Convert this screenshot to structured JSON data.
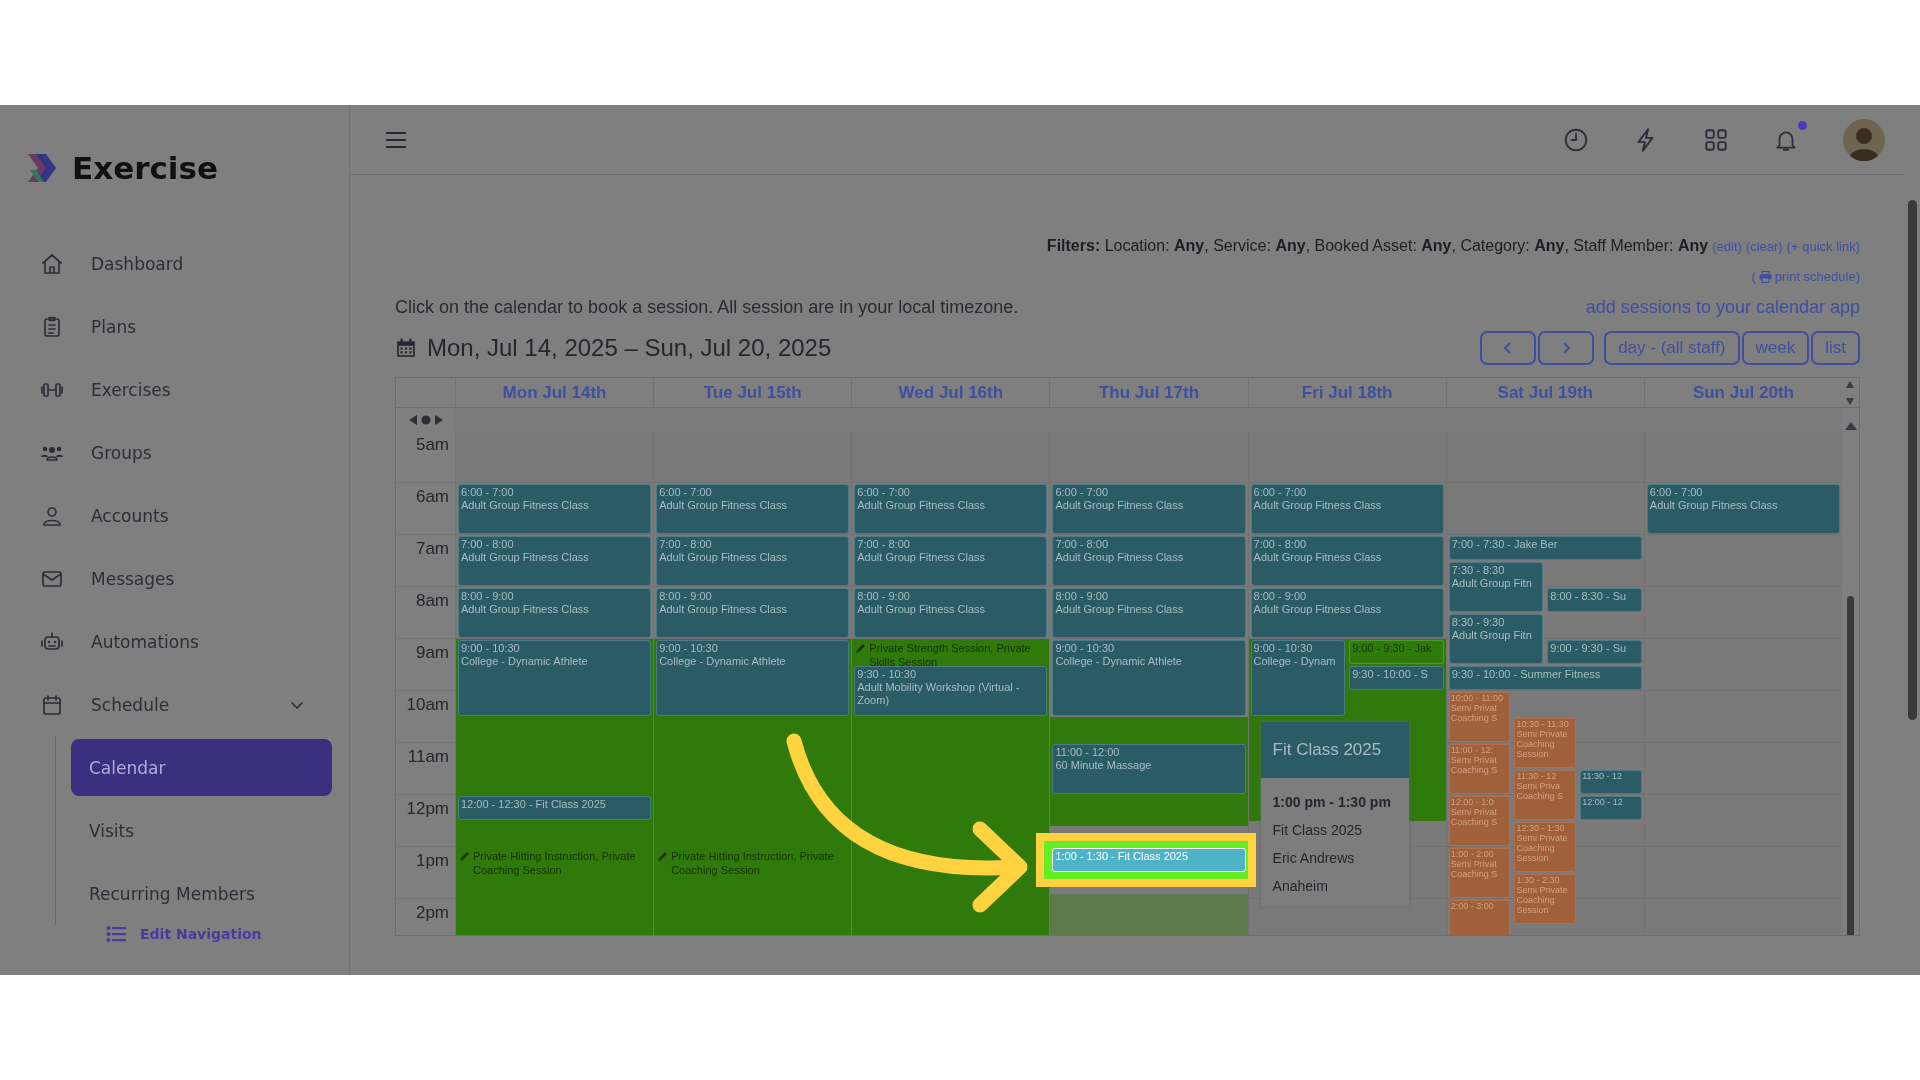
{
  "app": {
    "name": "Exercise"
  },
  "sidebar": {
    "items": [
      {
        "label": "Dashboard"
      },
      {
        "label": "Plans"
      },
      {
        "label": "Exercises"
      },
      {
        "label": "Groups"
      },
      {
        "label": "Accounts"
      },
      {
        "label": "Messages"
      },
      {
        "label": "Automations"
      },
      {
        "label": "Schedule",
        "expanded": true,
        "children": [
          {
            "label": "Calendar",
            "selected": true
          },
          {
            "label": "Visits",
            "selected": false
          },
          {
            "label": "Recurring Members",
            "selected": false
          }
        ]
      }
    ],
    "edit_link": "Edit Navigation"
  },
  "topbar": {
    "notifications_unread": true
  },
  "filters": {
    "text": "**Filters:** Location: **Any**, Service: **Any**, Booked Asset: **Any**, Category: **Any**, Staff Member: **Any**",
    "links": [
      "(edit)",
      "(clear)",
      "(+ quick link)"
    ]
  },
  "print_link": {
    "parts": [
      "(",
      "print schedule)"
    ]
  },
  "instructions": "Click on the calendar to book a session. All session are in your local timezone.",
  "calendar_app_link": "add sessions to your calendar app",
  "date_range": "Mon, Jul 14, 2025 – Sun, Jul 20, 2025",
  "view_buttons": [
    "day - (all staff)",
    "week",
    "list"
  ],
  "calendar": {
    "hours": [
      "5am",
      "6am",
      "7am",
      "8am",
      "9am",
      "10am",
      "11am",
      "12pm",
      "1pm",
      "2pm"
    ],
    "days": [
      {
        "header": "Mon Jul 14th",
        "availability": [
          {
            "kind": "open"
          },
          {
            "kind": "open",
            "label": "Private Hitting Instruction, Private Coaching Session"
          }
        ],
        "events": [
          {
            "kind": "class",
            "time": "6:00 - 7:00",
            "title": "Adult Group Fitness Class",
            "highlighted": false
          },
          {
            "kind": "class",
            "time": "7:00 - 8:00",
            "title": "Adult Group Fitness Class",
            "highlighted": false
          },
          {
            "kind": "class",
            "time": "8:00 - 9:00",
            "title": "Adult Group Fitness Class",
            "highlighted": false
          },
          {
            "kind": "class",
            "time": "9:00 - 10:30",
            "title": "College - Dynamic Athlete",
            "highlighted": false
          },
          {
            "kind": "class",
            "time": "12:00 - 12:30 - Fit Class 2025",
            "highlighted": false
          }
        ]
      },
      {
        "header": "Tue Jul 15th",
        "availability": [
          {
            "kind": "open"
          },
          {
            "kind": "open",
            "label": "Private Hitting Instruction, Private Coaching Session"
          }
        ],
        "events": [
          {
            "kind": "class",
            "time": "6:00 - 7:00",
            "title": "Adult Group Fitness Class",
            "highlighted": false
          },
          {
            "kind": "class",
            "time": "7:00 - 8:00",
            "title": "Adult Group Fitness Class",
            "highlighted": false
          },
          {
            "kind": "class",
            "time": "8:00 - 9:00",
            "title": "Adult Group Fitness Class",
            "highlighted": false
          },
          {
            "kind": "class",
            "time": "9:00 - 10:30",
            "title": "College - Dynamic Athlete",
            "highlighted": false
          }
        ]
      },
      {
        "header": "Wed Jul 16th",
        "availability": [
          {
            "kind": "open",
            "label": "Private Strength Session, Private Skills Session"
          },
          {
            "kind": "open"
          }
        ],
        "events": [
          {
            "kind": "class",
            "time": "6:00 - 7:00",
            "title": "Adult Group Fitness Class",
            "highlighted": false
          },
          {
            "kind": "class",
            "time": "7:00 - 8:00",
            "title": "Adult Group Fitness Class",
            "highlighted": false
          },
          {
            "kind": "class",
            "time": "8:00 - 9:00",
            "title": "Adult Group Fitness Class",
            "highlighted": false
          },
          {
            "kind": "class",
            "time": "9:30 - 10:30",
            "title": "Adult Mobility Workshop (Virtual - Zoom)",
            "highlighted": false
          }
        ]
      },
      {
        "header": "Thu Jul 17th",
        "availability": [
          {
            "kind": "open"
          },
          {
            "kind": "faded"
          }
        ],
        "events": [
          {
            "kind": "class",
            "time": "6:00 - 7:00",
            "title": "Adult Group Fitness Class",
            "highlighted": false
          },
          {
            "kind": "class",
            "time": "7:00 - 8:00",
            "title": "Adult Group Fitness Class",
            "highlighted": false
          },
          {
            "kind": "class",
            "time": "8:00 - 9:00",
            "title": "Adult Group Fitness Class",
            "highlighted": false
          },
          {
            "kind": "class",
            "time": "9:00 - 10:30",
            "title": "College - Dynamic Athlete",
            "highlighted": false
          },
          {
            "kind": "class",
            "time": "11:00 - 12:00",
            "title": "60 Minute Massage",
            "highlighted": false
          },
          {
            "kind": "class",
            "time": "1:00 - 1:30 - Fit Class 2025",
            "highlighted": true
          }
        ]
      },
      {
        "header": "Fri Jul 18th",
        "availability": [
          {
            "kind": "open"
          }
        ],
        "events": [
          {
            "kind": "class",
            "time": "6:00 - 7:00",
            "title": "Adult Group Fitness Class",
            "highlighted": false
          },
          {
            "kind": "class",
            "time": "7:00 - 8:00",
            "title": "Adult Group Fitness Class",
            "highlighted": false
          },
          {
            "kind": "class",
            "time": "8:00 - 9:00",
            "title": "Adult Group Fitness Class",
            "highlighted": false
          },
          {
            "kind": "class",
            "time": "9:00 - 10:30",
            "title": "College - Dynam",
            "highlighted": false
          },
          {
            "kind": "private",
            "time": "9:00 - 9:30 - Jak",
            "highlighted": false
          },
          {
            "kind": "class",
            "time": "9:30 - 10:00 - S",
            "highlighted": false
          }
        ]
      },
      {
        "header": "Sat Jul 19th",
        "events": [
          {
            "kind": "class",
            "time": "7:00 - 7:30 - Jake Ber",
            "highlighted": false
          },
          {
            "kind": "class",
            "time": "7:30 - 8:30",
            "title": "Adult Group Fitn",
            "highlighted": false
          },
          {
            "kind": "class",
            "time": "8:00 - 8:30 - Su",
            "highlighted": false
          },
          {
            "kind": "class",
            "time": "8:30 - 9:30",
            "title": "Adult Group Fitn",
            "highlighted": false
          },
          {
            "kind": "class",
            "time": "9:00 - 9:30 - Su",
            "highlighted": false
          },
          {
            "kind": "class",
            "time": "9:30 - 10:00 - Summer Fitness",
            "highlighted": false
          },
          {
            "kind": "semi",
            "time": "10:00 - 11:00",
            "title": "Semi Privat Coaching S",
            "highlighted": false
          },
          {
            "kind": "semi",
            "time": "10:30 - 11:30",
            "title": "Semi Private Coaching Session",
            "highlighted": false
          },
          {
            "kind": "semi",
            "time": "11:00 - 12:",
            "title": "Semi Privat Coaching S",
            "highlighted": false
          },
          {
            "kind": "semi",
            "time": "11:30 - 12",
            "title": "Semi Priva Coaching S",
            "highlighted": false
          },
          {
            "kind": "class",
            "time": "11:30 - 12",
            "highlighted": false
          },
          {
            "kind": "semi",
            "time": "12:00 - 1:0",
            "title": "Semi Privat Coaching S",
            "highlighted": false
          },
          {
            "kind": "class",
            "time": "12:00 - 12",
            "highlighted": false
          },
          {
            "kind": "semi",
            "time": "12:30 - 1:30",
            "title": "Semi Private Coaching Session",
            "highlighted": false
          },
          {
            "kind": "semi",
            "time": "1:00 - 2:00",
            "title": "Semi Privat Coaching S",
            "highlighted": false
          },
          {
            "kind": "semi",
            "time": "2:00 - 3:00",
            "highlighted": false
          },
          {
            "kind": "semi",
            "time": "1:30 - 2:30",
            "title": "Semi Private Coaching Session",
            "highlighted": false
          }
        ]
      },
      {
        "header": "Sun Jul 20th",
        "events": [
          {
            "kind": "class",
            "time": "6:00 - 7:00",
            "title": "Adult Group Fitness Class",
            "highlighted": false
          }
        ]
      }
    ],
    "popover": {
      "title": "Fit Class 2025",
      "time": "1:00 pm - 1:30 pm",
      "lines": [
        "Fit Class 2025",
        "Eric Andrews",
        "Anaheim"
      ]
    }
  }
}
